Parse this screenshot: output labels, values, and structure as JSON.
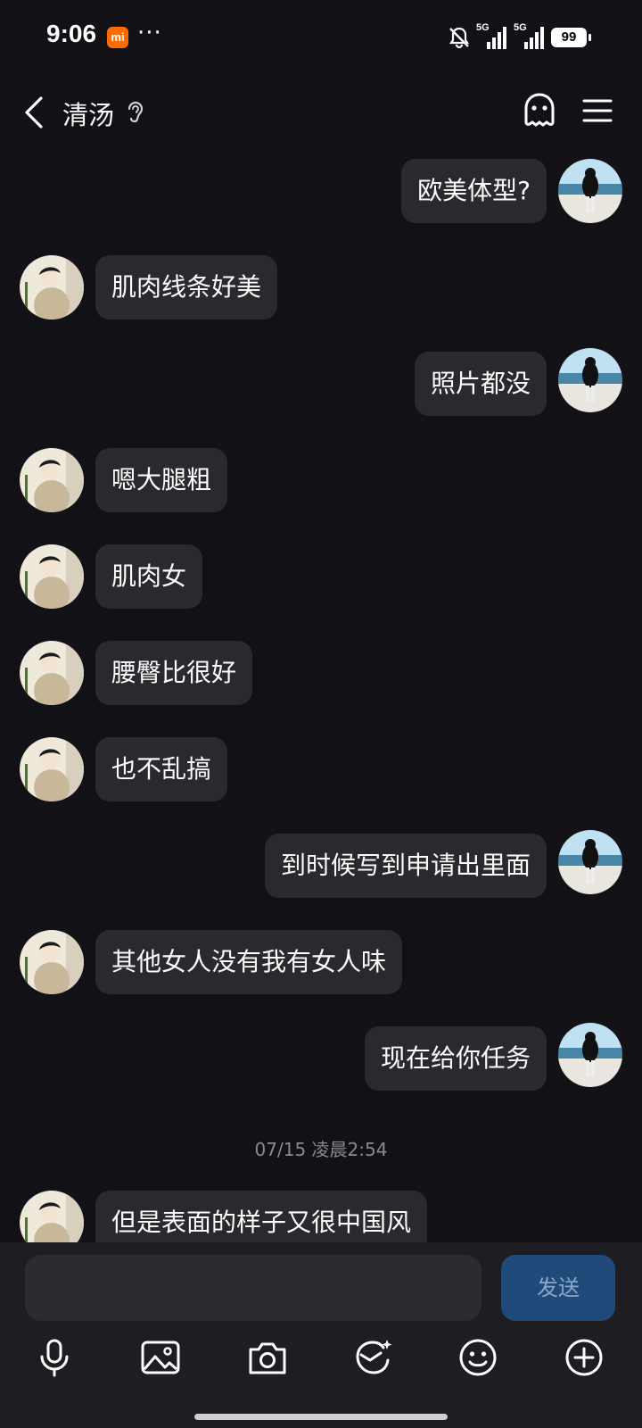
{
  "status_bar": {
    "time": "9:06",
    "app_badge": "mi",
    "more": "···",
    "network_1": "5G",
    "network_2": "5G",
    "battery": "99"
  },
  "header": {
    "back_icon": "chevron-left-icon",
    "contact_name": "清汤",
    "ear_icon": "ear-icon",
    "ghost_icon": "ghost-icon",
    "menu_icon": "menu-icon"
  },
  "messages": [
    {
      "side": "right",
      "text": "欧美体型?"
    },
    {
      "side": "left",
      "text": "肌肉线条好美"
    },
    {
      "side": "right",
      "text": "照片都没"
    },
    {
      "side": "left",
      "text": "嗯大腿粗"
    },
    {
      "side": "left",
      "text": "肌肉女"
    },
    {
      "side": "left",
      "text": "腰臀比很好"
    },
    {
      "side": "left",
      "text": "也不乱搞"
    },
    {
      "side": "right",
      "text": "到时候写到申请出里面"
    },
    {
      "side": "left",
      "text": "其他女人没有我有女人味"
    },
    {
      "side": "right",
      "text": "现在给你任务"
    },
    {
      "side": "left",
      "text": "但是表面的样子又很中国风"
    }
  ],
  "timestamp": "07/15 凌晨2:54",
  "input": {
    "value": "",
    "placeholder": "",
    "send_label": "发送"
  },
  "toolbar": [
    {
      "icon": "microphone-icon"
    },
    {
      "icon": "image-icon"
    },
    {
      "icon": "camera-icon"
    },
    {
      "icon": "sticker-icon"
    },
    {
      "icon": "emoji-icon"
    },
    {
      "icon": "plus-circle-icon"
    }
  ],
  "colors": {
    "background": "#121216",
    "bubble": "#2a2a2e",
    "send_button": "#1f4a7a",
    "input_bar": "#1e1e22"
  }
}
